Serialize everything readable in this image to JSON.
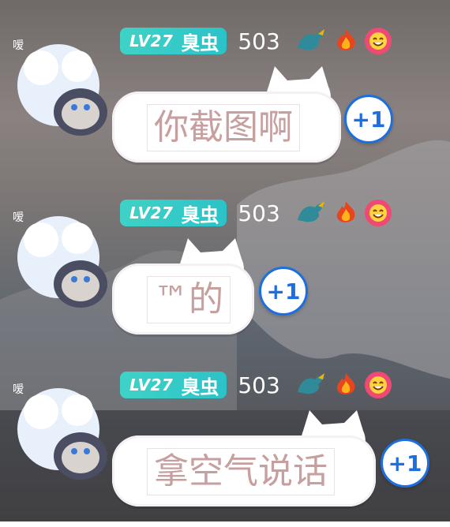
{
  "messages": [
    {
      "level": "LV27",
      "username": "臭虫",
      "score": "503",
      "text": "你截图啊",
      "plus": "+1",
      "badge_icons": [
        "dragon-badge-icon",
        "fire-icon",
        "smile-flower-icon"
      ]
    },
    {
      "level": "LV27",
      "username": "臭虫",
      "score": "503",
      "text": "™的",
      "plus": "+1",
      "badge_icons": [
        "dragon-badge-icon",
        "fire-icon",
        "smile-flower-icon"
      ]
    },
    {
      "level": "LV27",
      "username": "臭虫",
      "score": "503",
      "text": "拿空气说话",
      "plus": "+1",
      "badge_icons": [
        "dragon-badge-icon",
        "fire-icon",
        "smile-flower-icon"
      ]
    }
  ],
  "colors": {
    "level_badge": "#2bc3c8",
    "plus_accent": "#1d6fe0",
    "message_text": "#c79f9f"
  }
}
